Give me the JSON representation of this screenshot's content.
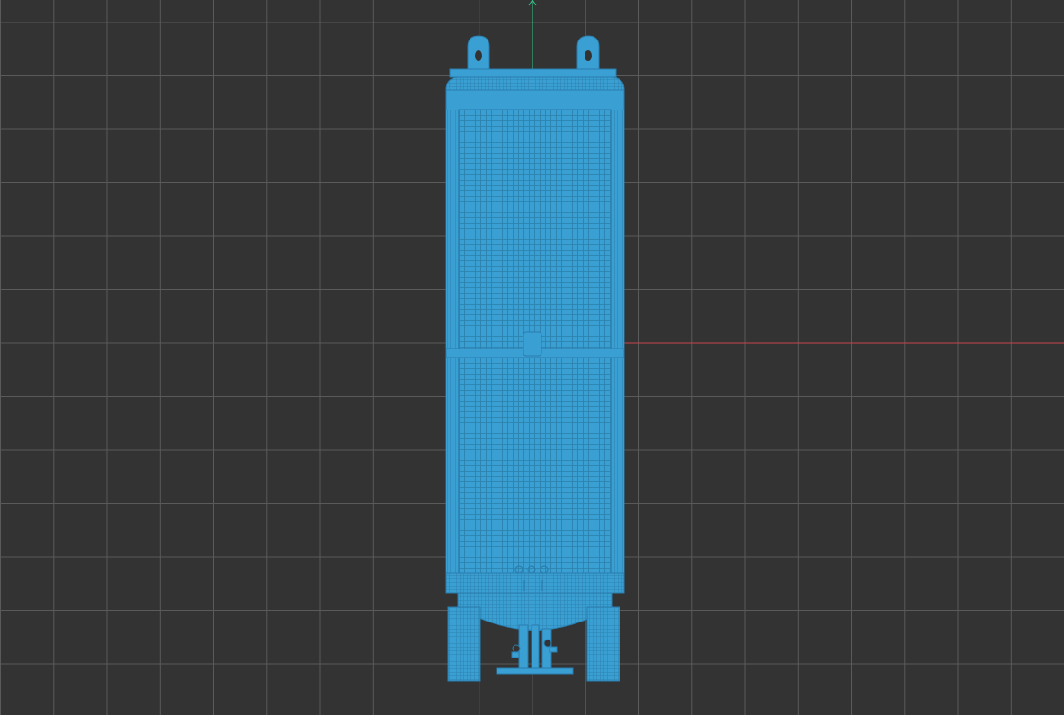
{
  "viewport": {
    "view": "orthographic-front",
    "shading": "wireframe",
    "grid_visible": true,
    "colors": {
      "background": "#333333",
      "grid_line": "#5a5a5a",
      "x_axis": "#c8454f",
      "y_axis": "#35c98e",
      "model_wire": "#3a9fd2",
      "model_wire_dense": "#2e85b3",
      "model_edge": "#2a7eae"
    }
  },
  "model": {
    "name": "vertical-cryogenic-tank",
    "parts": [
      "top-flange",
      "lifting-lugs",
      "upper-shell",
      "middle-seam",
      "seam-fitting",
      "lower-shell",
      "bottom-skirt",
      "support-legs",
      "bottom-piping",
      "base-plate"
    ]
  }
}
